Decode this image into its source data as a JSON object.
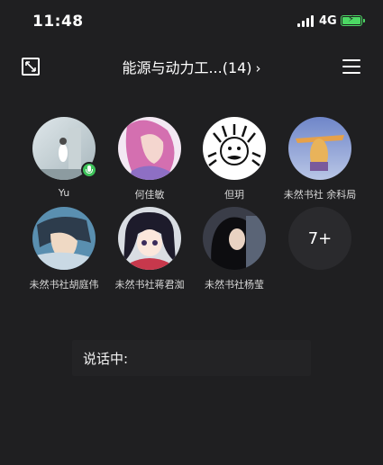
{
  "status_bar": {
    "time": "11:48",
    "network": "4G",
    "battery_color": "#4cd964"
  },
  "header": {
    "title": "能源与动力工...(14)",
    "chevron": "›",
    "minimize_icon": "minimize-arrows-icon",
    "menu_icon": "hamburger-menu-icon"
  },
  "participants": [
    {
      "name": "Yu",
      "speaking": true
    },
    {
      "name": "何佳敏",
      "speaking": false
    },
    {
      "name": "但玥",
      "speaking": false
    },
    {
      "name": "未然书社 余科局",
      "speaking": false
    },
    {
      "name": "未然书社胡庭伟",
      "speaking": false
    },
    {
      "name": "未然书社蒋君洳",
      "speaking": false
    },
    {
      "name": "未然书社杨莹",
      "speaking": false
    }
  ],
  "more": {
    "label": "7+"
  },
  "speaking": {
    "label": "说话中:"
  }
}
